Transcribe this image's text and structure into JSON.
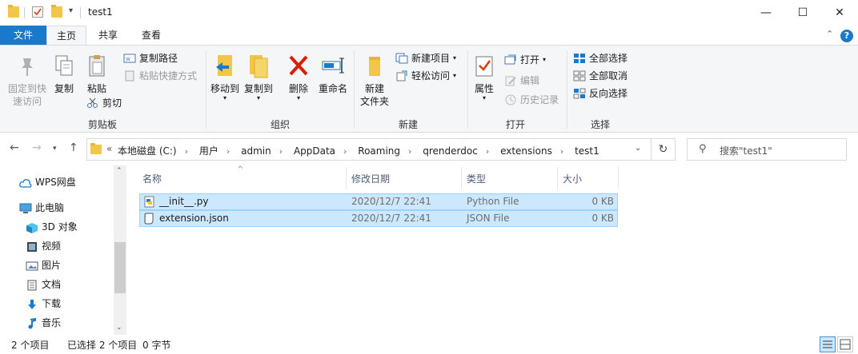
{
  "window": {
    "title": "test1",
    "controls": {
      "minimize": "—",
      "maximize": "☐",
      "close": "✕"
    }
  },
  "tabs": [
    {
      "label": "文件"
    },
    {
      "label": "主页"
    },
    {
      "label": "共享"
    },
    {
      "label": "查看"
    }
  ],
  "ribbon": {
    "clipboard": {
      "label": "剪贴板",
      "pin": "固定到快\n速访问",
      "copy": "复制",
      "paste": "粘贴",
      "copy_path": "复制路径",
      "paste_shortcut": "粘贴快捷方式",
      "cut": "剪切"
    },
    "organize": {
      "label": "组织",
      "move_to": "移动到",
      "copy_to": "复制到",
      "delete": "删除",
      "rename": "重命名"
    },
    "new": {
      "label": "新建",
      "new_folder": "新建\n文件夹",
      "new_item": "新建项目",
      "easy_access": "轻松访问"
    },
    "open": {
      "label": "打开",
      "properties": "属性",
      "open": "打开",
      "edit": "编辑",
      "history": "历史记录"
    },
    "select": {
      "label": "选择",
      "select_all": "全部选择",
      "select_none": "全部取消",
      "invert": "反向选择"
    }
  },
  "address": {
    "prefix": "«",
    "crumbs": [
      "本地磁盘 (C:)",
      "用户",
      "admin",
      "AppData",
      "Roaming",
      "qrenderdoc",
      "extensions",
      "test1"
    ],
    "search_placeholder": "搜索\"test1\""
  },
  "nav": [
    {
      "label": "WPS网盘",
      "icon": "cloud-icon"
    },
    {
      "label": "此电脑",
      "icon": "computer-icon"
    },
    {
      "label": "3D 对象",
      "icon": "cube-icon"
    },
    {
      "label": "视频",
      "icon": "video-icon"
    },
    {
      "label": "图片",
      "icon": "picture-icon"
    },
    {
      "label": "文档",
      "icon": "document-icon"
    },
    {
      "label": "下载",
      "icon": "download-icon"
    },
    {
      "label": "音乐",
      "icon": "music-icon"
    }
  ],
  "columns": {
    "name": "名称",
    "date": "修改日期",
    "type": "类型",
    "size": "大小"
  },
  "files": [
    {
      "name": "__init__.py",
      "date": "2020/12/7 22:41",
      "type": "Python File",
      "size": "0 KB",
      "icon": "python-file-icon"
    },
    {
      "name": "extension.json",
      "date": "2020/12/7 22:41",
      "type": "JSON File",
      "size": "0 KB",
      "icon": "json-file-icon"
    }
  ],
  "status": {
    "count": "2 个项目",
    "selected": "已选择 2 个项目",
    "size": "0 字节"
  },
  "colors": {
    "accent": "#1979ca",
    "selection": "#cce8ff",
    "selection_border": "#99d1ff",
    "delete_red": "#d81e06",
    "folder_yellow": "#f3c64a"
  }
}
